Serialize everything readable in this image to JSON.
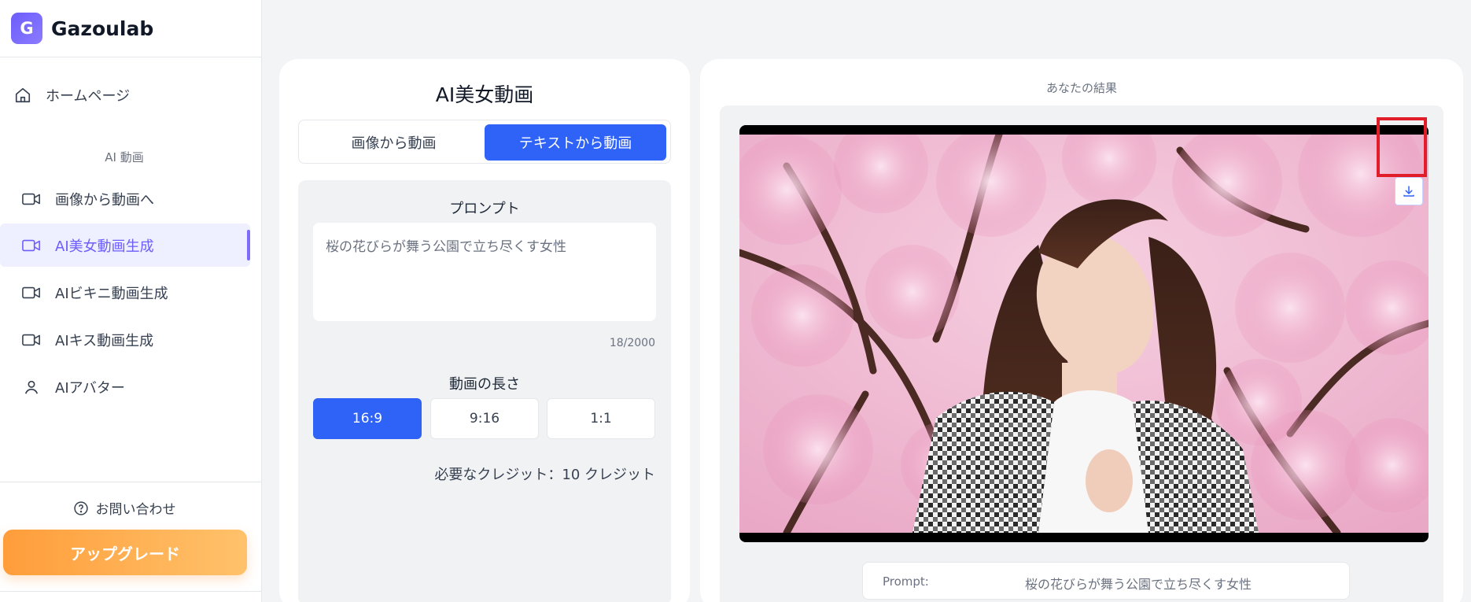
{
  "brand": {
    "logo_letter": "G",
    "name": "Gazoulab",
    "color": "#6d5dfc"
  },
  "sidebar": {
    "home_label": "ホームページ",
    "section_title": "AI 動画",
    "items": [
      {
        "label": "画像から動画へ",
        "icon": "video-camera-icon",
        "active": false
      },
      {
        "label": "AI美女動画生成",
        "icon": "video-camera-icon",
        "active": true
      },
      {
        "label": "AIビキニ動画生成",
        "icon": "video-camera-icon",
        "active": false
      },
      {
        "label": "AIキス動画生成",
        "icon": "video-camera-icon",
        "active": false
      },
      {
        "label": "AIアバター",
        "icon": "user-icon",
        "active": false
      }
    ],
    "contact_label": "お問い合わせ",
    "upgrade_label": "アップグレード"
  },
  "generator": {
    "title": "AI美女動画",
    "tabs": [
      {
        "label": "画像から動画",
        "active": false
      },
      {
        "label": "テキストから動画",
        "active": true
      }
    ],
    "prompt_label": "プロンプト",
    "prompt_value": "桜の花びらが舞う公園で立ち尽くす女性",
    "char_count": "18/2000",
    "length_label": "動画の長さ",
    "ratios": [
      {
        "label": "16:9",
        "selected": true
      },
      {
        "label": "9:16",
        "selected": false
      },
      {
        "label": "1:1",
        "selected": false
      }
    ],
    "credits_text": "必要なクレジット：10 クレジット"
  },
  "result": {
    "title": "あなたの結果",
    "prompt_key": "Prompt:",
    "prompt_value": "桜の花びらが舞う公園で立ち尽くす女性"
  },
  "colors": {
    "primary": "#2f62f6",
    "accent": "#6d5dfc",
    "upgrade_gradient": [
      "#ff9d3a",
      "#ffc26b"
    ],
    "highlight": "#e11d2a"
  }
}
